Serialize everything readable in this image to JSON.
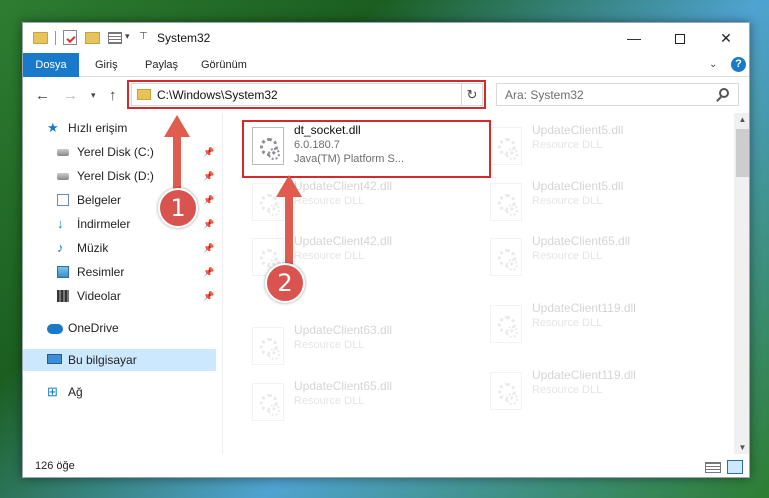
{
  "window": {
    "title": "System32",
    "minimize": "—",
    "close": "✕"
  },
  "ribbon": {
    "tabs": [
      "Dosya",
      "Giriş",
      "Paylaş",
      "Görünüm"
    ],
    "help": "?"
  },
  "nav": {
    "address": "C:\\Windows\\System32",
    "search_placeholder": "Ara: System32"
  },
  "sidebar": {
    "items": [
      {
        "label": "Hızlı erişim",
        "icon": "star-icon",
        "pinned": false
      },
      {
        "label": "Yerel Disk (C:)",
        "icon": "drive-icon",
        "pinned": true
      },
      {
        "label": "Yerel Disk (D:)",
        "icon": "drive-icon",
        "pinned": true
      },
      {
        "label": "Belgeler",
        "icon": "documents-icon",
        "pinned": true
      },
      {
        "label": "İndirmeler",
        "icon": "downloads-icon",
        "pinned": true
      },
      {
        "label": "Müzik",
        "icon": "music-icon",
        "pinned": true
      },
      {
        "label": "Resimler",
        "icon": "pictures-icon",
        "pinned": true
      },
      {
        "label": "Videolar",
        "icon": "videos-icon",
        "pinned": true
      },
      {
        "label": "OneDrive",
        "icon": "cloud-icon",
        "pinned": false
      },
      {
        "label": "Bu bilgisayar",
        "icon": "computer-icon",
        "pinned": false
      },
      {
        "label": "Ağ",
        "icon": "network-icon",
        "pinned": false
      }
    ],
    "selected": "Bu bilgisayar"
  },
  "files": {
    "highlighted": {
      "name": "dt_socket.dll",
      "version": "6.0.180.7",
      "description": "Java(TM) Platform S..."
    },
    "left_column": [
      {
        "name": "UpdateClient42.dll",
        "description": "Resource DLL"
      },
      {
        "name": "UpdateClient42.dll",
        "description": "Resource DLL"
      },
      {
        "name": "UpdateClient63.dll",
        "description": "Resource DLL"
      },
      {
        "name": "UpdateClient65.dll",
        "description": "Resource DLL"
      }
    ],
    "right_column": [
      {
        "name": "UpdateClient5.dll",
        "description": "Resource DLL"
      },
      {
        "name": "UpdateClient5.dll",
        "description": "Resource DLL"
      },
      {
        "name": "UpdateClient65.dll",
        "description": "Resource DLL"
      },
      {
        "name": "UpdateClient119.dll",
        "description": "Resource DLL"
      },
      {
        "name": "UpdateClient119.dll",
        "description": "Resource DLL"
      }
    ]
  },
  "status": {
    "item_count": "126 öğe"
  },
  "callouts": {
    "step1": "1",
    "step2": "2"
  },
  "colors": {
    "accent": "#1979ca",
    "highlight_box": "#d62a2a",
    "callout": "#d9534f",
    "selection": "#cce8ff"
  }
}
